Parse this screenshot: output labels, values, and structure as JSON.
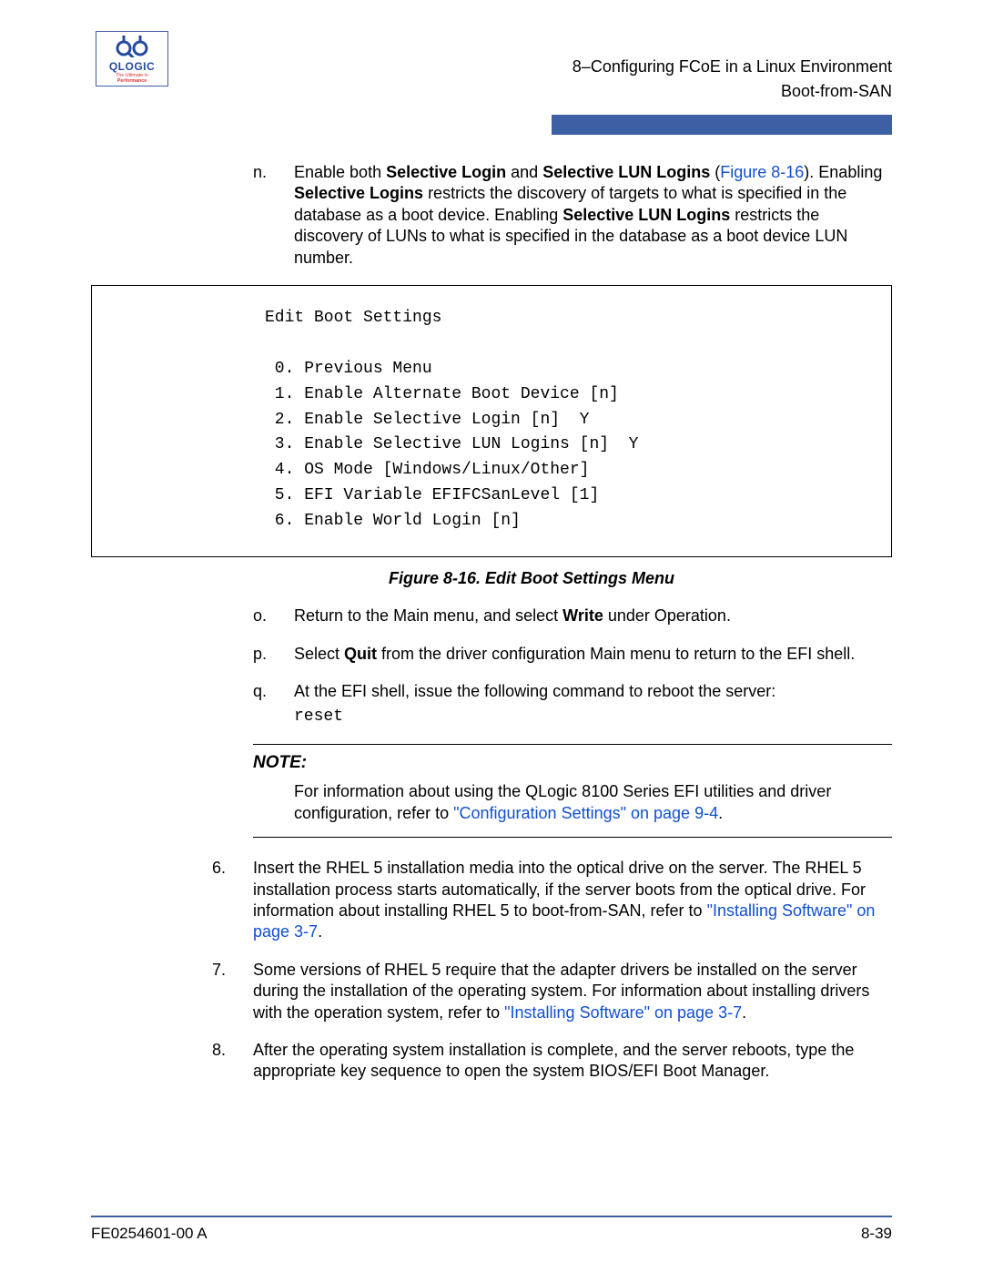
{
  "logo": {
    "brand": "QLOGIC",
    "tagline_pre": "The Ultimate in ",
    "tagline_bold": "Performance"
  },
  "header": {
    "chapter": "8–Configuring FCoE in a Linux Environment",
    "section": "Boot-from-SAN"
  },
  "step_n": {
    "marker": "n.",
    "t1": "Enable both ",
    "b1": "Selective Login",
    "t2": " and ",
    "b2": "Selective LUN Logins",
    "t3": " (",
    "link": "Figure 8-16",
    "t4": "). Enabling ",
    "b3": "Selective Logins",
    "t5": " restricts the discovery of targets to what is specified in the database as a boot device. Enabling ",
    "b4": "Selective LUN Logins",
    "t6": " restricts the discovery of LUNs to what is specified in the database as a boot device LUN number."
  },
  "codebox": "Edit Boot Settings\n\n 0. Previous Menu\n 1. Enable Alternate Boot Device [n]\n 2. Enable Selective Login [n]  Y\n 3. Enable Selective LUN Logins [n]  Y\n 4. OS Mode [Windows/Linux/Other]\n 5. EFI Variable EFIFCSanLevel [1]\n 6. Enable World Login [n]",
  "figcaption": "Figure 8-16. Edit Boot Settings Menu",
  "step_o": {
    "marker": "o.",
    "t1": "Return to the Main menu, and select ",
    "b1": "Write",
    "t2": " under Operation."
  },
  "step_p": {
    "marker": "p.",
    "t1": "Select ",
    "b1": "Quit",
    "t2": " from the driver configuration Main menu to return to the EFI shell."
  },
  "step_q": {
    "marker": "q.",
    "text": "At the EFI shell, issue the following command to reboot the server:",
    "cmd": "reset"
  },
  "note": {
    "heading": "NOTE:",
    "t1": "For information about using the QLogic 8100 Series EFI utilities and driver configuration, refer to ",
    "link": "\"Configuration Settings\" on page 9-4",
    "t2": "."
  },
  "step_6": {
    "marker": "6.",
    "t1": "Insert the RHEL 5 installation media into the optical drive on the server. The RHEL 5 installation process starts automatically, if the server boots from the optical drive. For information about installing RHEL 5 to boot-from-SAN, refer to ",
    "link": "\"Installing Software\" on page 3-7",
    "t2": "."
  },
  "step_7": {
    "marker": "7.",
    "t1": "Some versions of RHEL 5 require that the adapter drivers be installed on the server during the installation of the operating system. For information about installing drivers with the operation system, refer to ",
    "link": "\"Installing Software\" on page 3-7",
    "t2": "."
  },
  "step_8": {
    "marker": "8.",
    "text": "After the operating system installation is complete, and the server reboots, type the appropriate key sequence to open the system BIOS/EFI Boot Manager."
  },
  "footer": {
    "left": "FE0254601-00 A",
    "right": "8-39"
  }
}
